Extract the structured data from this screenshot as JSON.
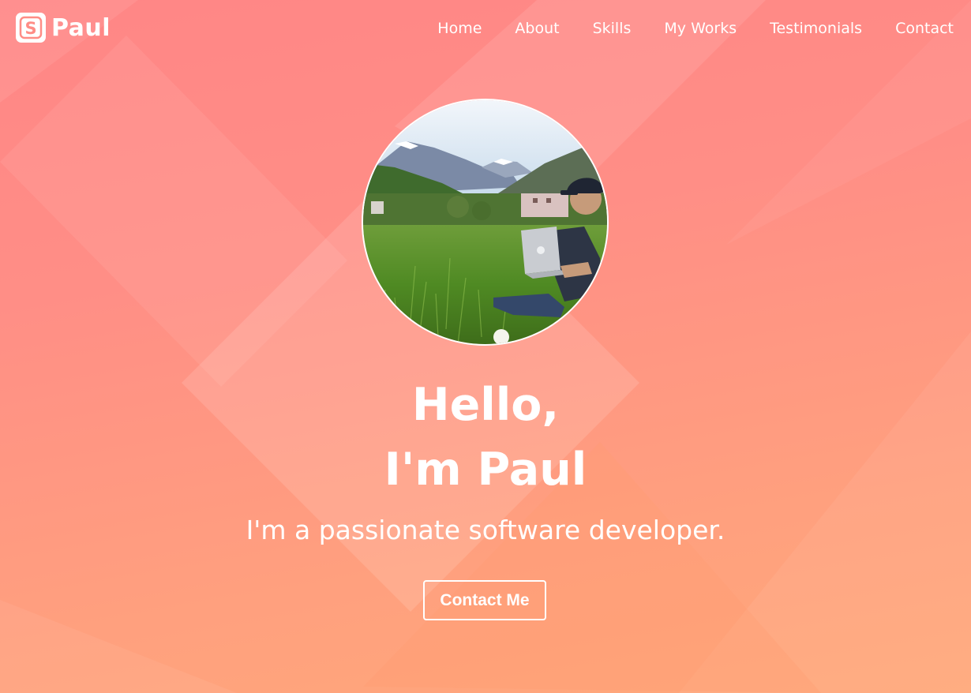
{
  "navbar": {
    "brand": {
      "logo_letter": "S",
      "name": "Paul",
      "logo_icon": "s-logo-icon"
    },
    "links": [
      {
        "label": "Home"
      },
      {
        "label": "About"
      },
      {
        "label": "Skills"
      },
      {
        "label": "My Works"
      },
      {
        "label": "Testimonials"
      },
      {
        "label": "Contact"
      }
    ]
  },
  "hero": {
    "avatar": {
      "description_icon": "profile-photo",
      "alt": "Paul"
    },
    "greeting_line1": "Hello,",
    "greeting_line2": "I'm Paul",
    "tagline": "I'm a passionate software developer.",
    "cta_label": "Contact Me"
  },
  "colors": {
    "background_top": "#ff8686",
    "background_bottom": "#ffa87a",
    "text": "#ffffff",
    "logo_letter": "#ff8d86"
  }
}
